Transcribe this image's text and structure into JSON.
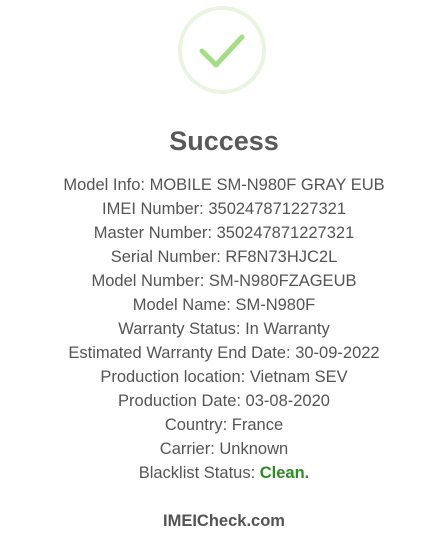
{
  "icon": "success-check-icon",
  "colors": {
    "check": "#a5dc86",
    "ring": "#e9f5e1",
    "text": "#545454",
    "clean": "#2e8b22"
  },
  "title": "Success",
  "info": [
    {
      "label": "Model Info",
      "value": "MOBILE SM-N980F GRAY EUB"
    },
    {
      "label": "IMEI Number",
      "value": "350247871227321"
    },
    {
      "label": "Master Number",
      "value": "350247871227321"
    },
    {
      "label": "Serial Number",
      "value": "RF8N73HJC2L"
    },
    {
      "label": "Model Number",
      "value": "SM-N980FZAGEUB"
    },
    {
      "label": "Model Name",
      "value": "SM-N980F"
    },
    {
      "label": "Warranty Status",
      "value": "In Warranty"
    },
    {
      "label": "Estimated Warranty End Date",
      "value": "30-09-2022"
    },
    {
      "label": "Production location",
      "value": "Vietnam SEV"
    },
    {
      "label": "Production Date",
      "value": "03-08-2020"
    },
    {
      "label": "Country",
      "value": "France"
    },
    {
      "label": "Carrier",
      "value": "Unknown"
    }
  ],
  "blacklist": {
    "label": "Blacklist Status",
    "value": "Clean."
  },
  "footer": "IMEICheck.com"
}
